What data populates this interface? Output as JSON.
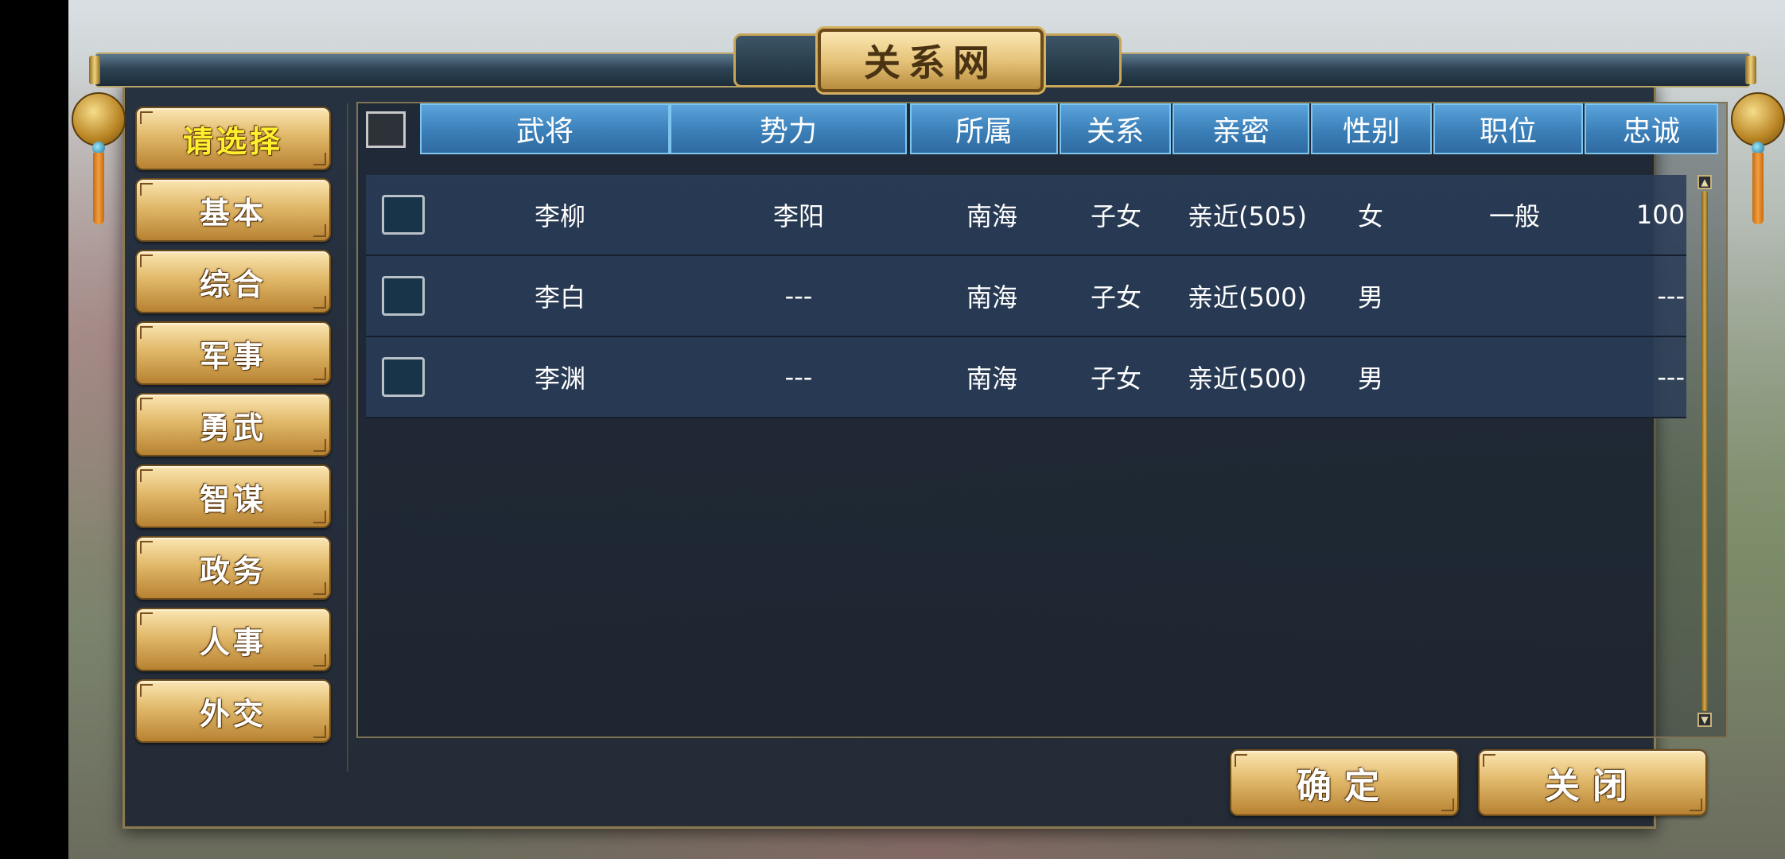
{
  "title": "关系网",
  "nav": [
    {
      "label": "请选择",
      "active": true
    },
    {
      "label": "基本",
      "active": false
    },
    {
      "label": "综合",
      "active": false
    },
    {
      "label": "军事",
      "active": false
    },
    {
      "label": "勇武",
      "active": false
    },
    {
      "label": "智谋",
      "active": false
    },
    {
      "label": "政务",
      "active": false
    },
    {
      "label": "人事",
      "active": false
    },
    {
      "label": "外交",
      "active": false
    }
  ],
  "table": {
    "headers": [
      "武将",
      "势力",
      "所属",
      "关系",
      "亲密",
      "性别",
      "职位",
      "忠诚"
    ],
    "rows": [
      [
        "李柳",
        "李阳",
        "南海",
        "子女",
        "亲近(505)",
        "女",
        "一般",
        "100"
      ],
      [
        "李白",
        "---",
        "南海",
        "子女",
        "亲近(500)",
        "男",
        "",
        "---"
      ],
      [
        "李渊",
        "---",
        "南海",
        "子女",
        "亲近(500)",
        "男",
        "",
        "---"
      ]
    ]
  },
  "buttons": {
    "confirm": "确定",
    "close": "关闭"
  },
  "colors": {
    "header_blue": "#3b7fb8",
    "active_text": "#ffef2e",
    "gold": "#e1b96a",
    "row_bg": "#2a3c58"
  }
}
